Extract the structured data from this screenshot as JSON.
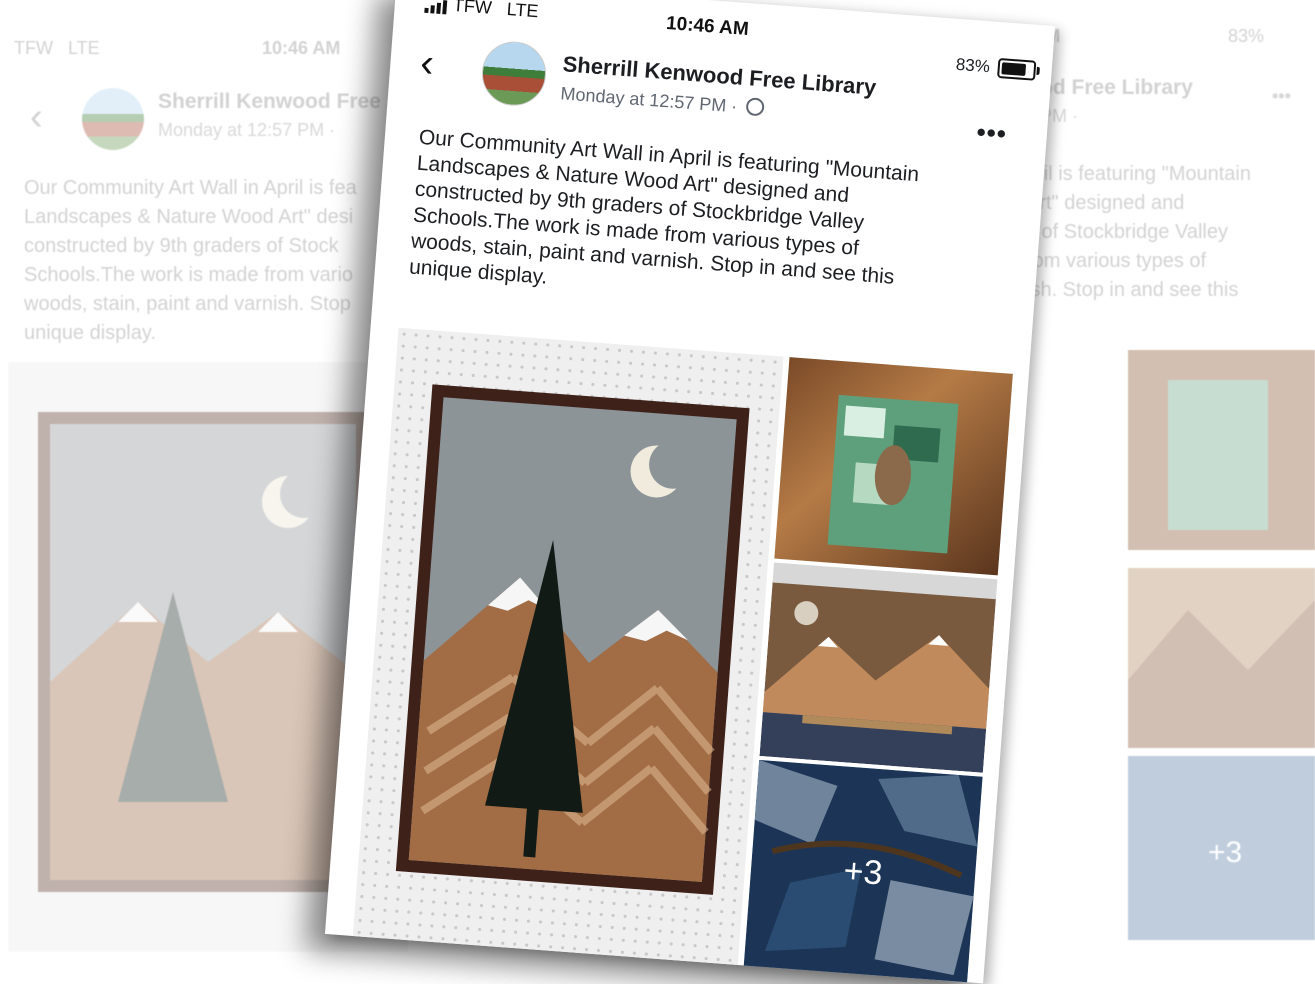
{
  "status_bar": {
    "carrier": "TFW",
    "network": "LTE",
    "time": "10:46 AM",
    "battery_percent": "83%"
  },
  "post": {
    "page_name": "Sherrill Kenwood Free Library",
    "timestamp": "Monday at 12:57 PM ·",
    "more_label": "•••",
    "text_lines": [
      "Our Community Art Wall in April is featuring \"Mountain",
      "Landscapes & Nature Wood Art\" designed and",
      "constructed  by 9th graders of Stockbridge Valley",
      "Schools.The work is made from various types of",
      "woods, stain, paint and varnish. Stop in and see this",
      "unique display."
    ],
    "extra_photos_label": "+3"
  },
  "background_left": {
    "name_partial": "Sherrill Kenwood Free Li",
    "text_lines": [
      "Our Community Art Wall in April is fea",
      "Landscapes & Nature Wood Art\" desi",
      "constructed  by 9th graders of Stock",
      "Schools.The work is made from vario",
      "woods, stain, paint and varnish. Stop",
      "unique display."
    ]
  },
  "background_right": {
    "name_partial": "od Free Library",
    "time_partial": "PM ·",
    "text_lines": [
      "pril is featuring \"Mountain",
      "Art\" designed and",
      "s of Stockbridge Valley",
      "rom various types of",
      "ish. Stop in and see this"
    ],
    "extra_photos_label": "+3"
  },
  "colors": {
    "accent_text": "#1c1e21",
    "secondary_text": "#606770",
    "frame_wood": "#4a2a1e",
    "panel_gray": "#8f969a"
  }
}
